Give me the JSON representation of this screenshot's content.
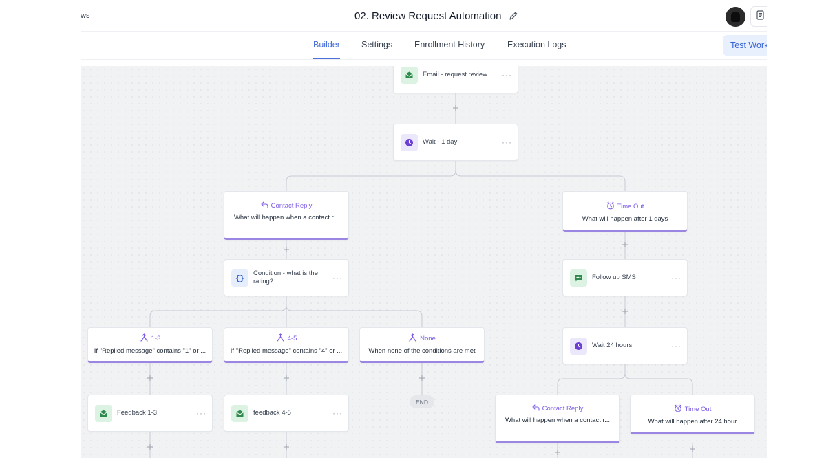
{
  "header": {
    "breadcrumb": "ws",
    "title": "02. Review Request Automation",
    "test_button": "Test Work"
  },
  "tabs": [
    {
      "label": "Builder",
      "active": true
    },
    {
      "label": "Settings",
      "active": false
    },
    {
      "label": "Enrollment History",
      "active": false
    },
    {
      "label": "Execution Logs",
      "active": false
    }
  ],
  "colors": {
    "accent": "#4a70d9",
    "branch": "#7c5ce6",
    "email_icon": "#2f8a4e",
    "wait_icon": "#6b3fd4"
  },
  "workflow": {
    "email_request": {
      "label": "Email - request review",
      "icon": "email-icon"
    },
    "wait_1_day": {
      "label": "Wait - 1 day",
      "icon": "clock-icon"
    },
    "contact_reply": {
      "title": "Contact Reply",
      "desc": "What will happen when a contact r...",
      "icon": "reply-icon"
    },
    "time_out": {
      "title": "Time Out",
      "desc": "What will happen after 1 days",
      "icon": "alarm-icon"
    },
    "condition": {
      "label": "Condition - what is the rating?",
      "icon": "braces-icon"
    },
    "follow_up_sms": {
      "label": "Follow up SMS",
      "icon": "sms-icon"
    },
    "wait_24": {
      "label": "Wait 24 hours",
      "icon": "clock-icon"
    },
    "branch_1_3": {
      "title": "1-3",
      "desc": "If \"Replied message\" contains \"1\" or ...",
      "icon": "split-icon"
    },
    "branch_4_5": {
      "title": "4-5",
      "desc": "If \"Replied message\" contains \"4\" or ...",
      "icon": "split-icon"
    },
    "branch_none": {
      "title": "None",
      "desc": "When none of the conditions are met",
      "icon": "split-icon"
    },
    "feedback_1_3": {
      "label": "Feedback 1-3",
      "icon": "email-icon"
    },
    "feedback_4_5": {
      "label": "feedback 4-5",
      "icon": "email-icon"
    },
    "end": "END",
    "contact_reply_2": {
      "title": "Contact Reply",
      "desc": "What will happen when a contact r...",
      "icon": "reply-icon"
    },
    "time_out_2": {
      "title": "Time Out",
      "desc": "What will happen after 24 hour",
      "icon": "alarm-icon"
    }
  }
}
